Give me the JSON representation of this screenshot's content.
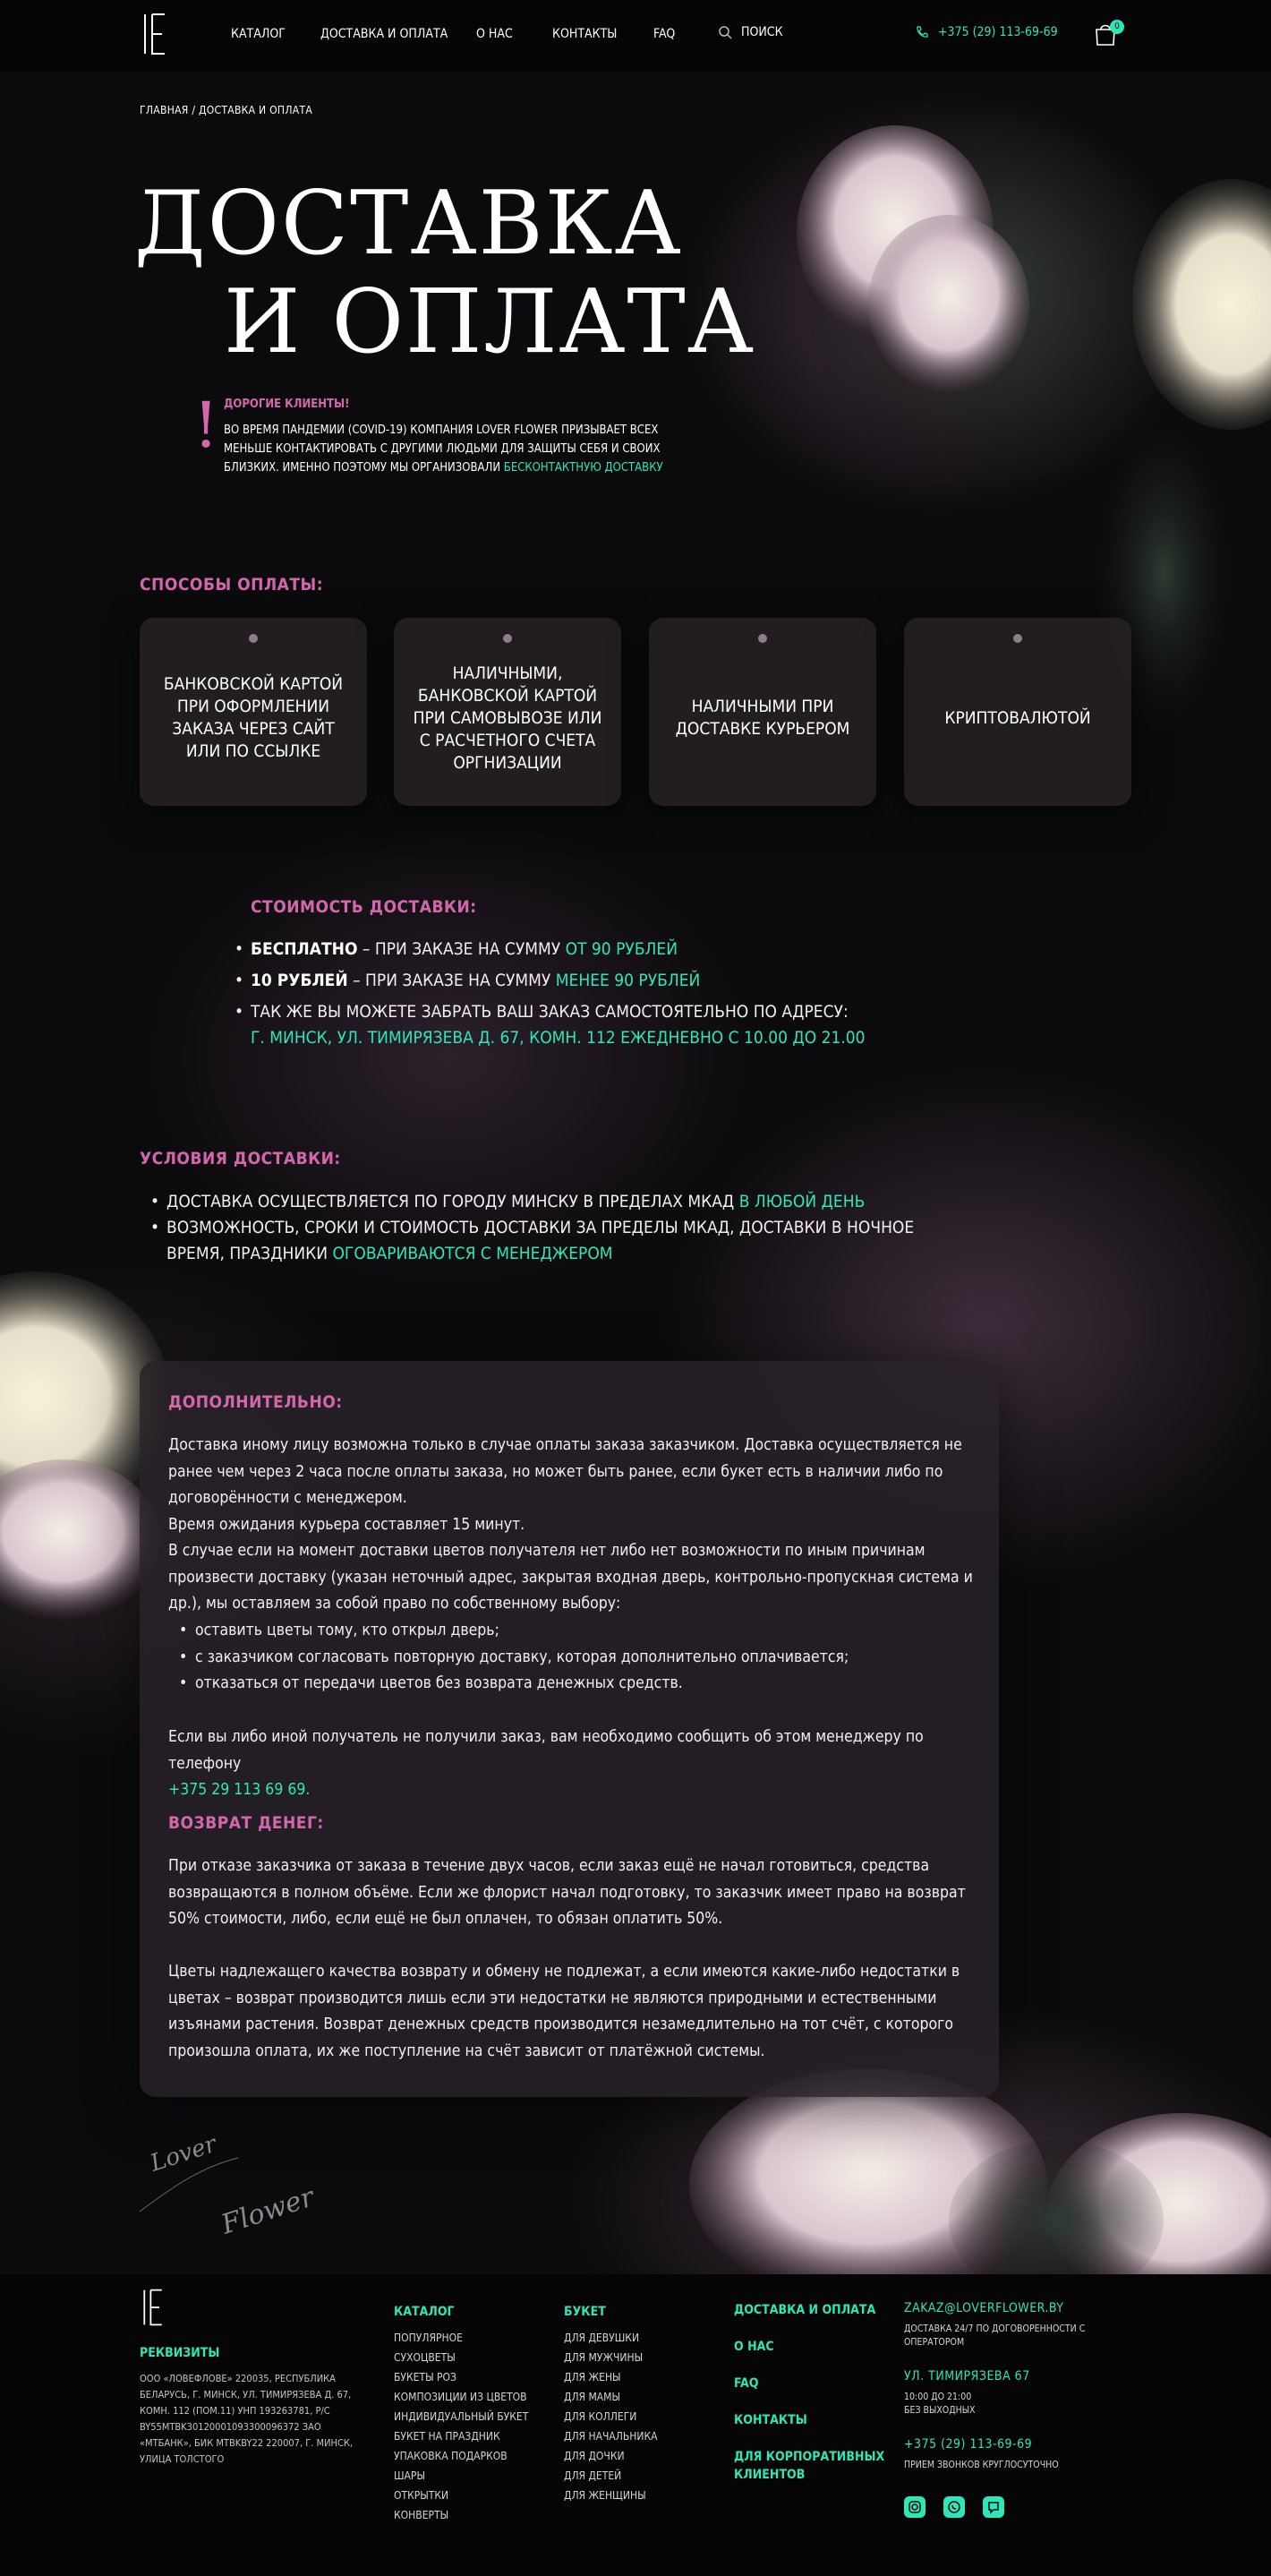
{
  "header": {
    "nav": [
      "КАТАЛОГ",
      "ДОСТАВКА И ОПЛАТА",
      "О НАС",
      "КОНТАКТЫ",
      "FAQ"
    ],
    "search_label": "ПОИСК",
    "phone": "+375 (29) 113-69-69",
    "cart_count": "0"
  },
  "breadcrumb": "ГЛАВНАЯ / ДОСТАВКА И ОПЛАТА",
  "title": {
    "line1": "ДОСТАВКА",
    "line2": "И ОПЛАТА"
  },
  "notice": {
    "mark": "!",
    "heading": "ДОРОГИЕ КЛИЕНТЫ!",
    "text": "ВО ВРЕМЯ ПАНДЕМИИ (COVID-19) КОМПАНИЯ LOVER FLOWER ПРИЗЫВАЕТ ВСЕХ МЕНЬШЕ КОНТАКТИРОВАТЬ С ДРУГИМИ ЛЮДЬМИ ДЛЯ ЗАЩИТЫ СЕБЯ И СВОИХ БЛИЗКИХ. ИМЕННО ПОЭТОМУ МЫ ОРГАНИЗОВАЛИ ",
    "link": "БЕСКОНТАКТНУЮ ДОСТАВКУ"
  },
  "payment": {
    "heading": "СПОСОБЫ ОПЛАТЫ:",
    "cards": [
      "БАНКОВСКОЙ КАРТОЙ ПРИ ОФОРМЛЕНИИ ЗАКАЗА ЧЕРЕЗ САЙТ ИЛИ ПО ССЫЛКЕ",
      "НАЛИЧНЫМИ, БАНКОВСКОЙ КАРТОЙ ПРИ САМОВЫВОЗЕ ИЛИ С РАСЧЕТНОГО СЧЕТА ОРГНИЗАЦИИ",
      "НАЛИЧНЫМИ ПРИ ДОСТАВКЕ КУРЬЕРОМ",
      "КРИПТОВАЛЮТОЙ"
    ]
  },
  "cost": {
    "heading": "СТОИМОСТЬ ДОСТАВКИ:",
    "free_bold": "БЕСПЛАТНО",
    "free_text": " – ПРИ ЗАКАЗЕ НА СУММУ ",
    "free_accent": "ОТ 90 РУБЛЕЙ",
    "paid_bold": "10 РУБЛЕЙ",
    "paid_text": " – ПРИ ЗАКАЗЕ НА СУММУ ",
    "paid_accent": "МЕНЕЕ 90 РУБЛЕЙ",
    "pickup_text": "ТАК ЖЕ ВЫ МОЖЕТЕ ЗАБРАТЬ ВАШ ЗАКАЗ САМОСТОЯТЕЛЬНО ПО АДРЕСУ:",
    "pickup_accent": "Г. МИНСК, УЛ. ТИМИРЯЗЕВА Д. 67, КОМН. 112 ЕЖЕДНЕВНО С 10.00 ДО 21.00"
  },
  "conditions": {
    "heading": "УСЛОВИЯ ДОСТАВКИ:",
    "item1_text": "ДОСТАВКА ОСУЩЕСТВЛЯЕТСЯ ПО ГОРОДУ МИНСКУ В ПРЕДЕЛАХ МКАД ",
    "item1_accent": "В ЛЮБОЙ ДЕНЬ",
    "item2_text": "ВОЗМОЖНОСТЬ, СРОКИ И СТОИМОСТЬ ДОСТАВКИ ЗА ПРЕДЕЛЫ МКАД, ДОСТАВКИ В НОЧНОЕ ВРЕМЯ, ПРАЗДНИКИ ",
    "item2_accent": "ОГОВАРИВАЮТСЯ С МЕНЕДЖЕРОМ"
  },
  "extra": {
    "heading": "ДОПОЛНИТЕЛЬНО:",
    "p1": "Доставка иному лицу возможна только в случае оплаты заказа заказчиком. Доставка осуществляется не ранее чем через 2 часа после оплаты заказа, но может быть ранее, если букет есть в наличии либо по договорённости с менеджером.",
    "p2": "Время ожидания курьера составляет 15 минут.",
    "p3": "В случае если на момент доставки цветов получателя нет либо нет возможности по иным причинам произвести доставку (указан неточный адрес, закрытая входная дверь, контрольно-пропускная система и др.), мы оставляем за собой право по собственному выбору:",
    "li1": "оставить цветы тому, кто открыл дверь;",
    "li2": "с заказчиком согласовать повторную доставку, которая дополнительно оплачивается;",
    "li3": "отказаться от передачи цветов без возврата денежных средств.",
    "p4": "Если вы либо иной получатель не получили заказ, вам необходимо сообщить об этом менеджеру по телефону",
    "p4_phone": "+375 29 113 69 69.",
    "refund_heading": "ВОЗВРАТ ДЕНЕГ:",
    "r1": "При отказе заказчика от заказа в течение двух часов, если заказ ещё не начал готовиться, средства возвращаются в полном объёме. Если же флорист начал подготовку, то заказчик имеет право на возврат 50% стоимости, либо, если ещё не был оплачен, то обязан оплатить 50%.",
    "r2": "Цветы надлежащего качества возврату и обмену не подлежат, а если имеются какие-либо недостатки в цветах – возврат производится лишь если эти недостатки не являются природными и естественными изъянами растения. Возврат денежных средств производится незамедлительно на тот счёт, с которого произошла оплата, их же поступление на счёт зависит от платёжной системы."
  },
  "signature": {
    "line1": "Lover",
    "line2": "Flower"
  },
  "footer": {
    "requisites_heading": "РЕКВИЗИТЫ",
    "requisites": "ООО «ЛОВЕФЛОВЕ» 220035, РЕСПУБЛИКА БЕЛАРУСЬ, Г. МИНСК, УЛ. ТИМИРЯЗЕВА Д. 67, КОМН. 112 (ПОМ.11) УНП 193263781, Р/С BY55MTBK30120001093300096372 ЗАО «МТБАНК», БИК MTBKBY22 220007, Г. МИНСК, УЛИЦА ТОЛСТОГО",
    "catalog_heading": "КАТАЛОГ",
    "catalog": [
      "ПОПУЛЯРНОЕ",
      "СУХОЦВЕТЫ",
      "БУКЕТЫ РОЗ",
      "КОМПОЗИЦИИ ИЗ ЦВЕТОВ",
      "ИНДИВИДУАЛЬНЫЙ БУКЕТ",
      "БУКЕТ НА ПРАЗДНИК",
      "УПАКОВКА ПОДАРКОВ",
      "ШАРЫ",
      "ОТКРЫТКИ",
      "КОНВЕРТЫ"
    ],
    "bouquet_heading": "БУКЕТ",
    "bouquet": [
      "ДЛЯ ДЕВУШКИ",
      "ДЛЯ МУЖЧИНЫ",
      "ДЛЯ ЖЕНЫ",
      "ДЛЯ МАМЫ",
      "ДЛЯ КОЛЛЕГИ",
      "ДЛЯ НАЧАЛЬНИКА",
      "ДЛЯ ДОЧКИ",
      "ДЛЯ ДЕТЕЙ",
      "ДЛЯ ЖЕНЩИНЫ"
    ],
    "links": [
      "ДОСТАВКА И ОПЛАТА",
      "О НАС",
      "FAQ",
      "КОНТАКТЫ",
      "ДЛЯ КОРПОРАТИВНЫХ КЛИЕНТОВ"
    ],
    "email": "ZAKAZ@LOVERFLOWER.BY",
    "email_note": "ДОСТАВКА 24/7 ПО ДОГОВОРЕННОСТИ С ОПЕРАТОРОМ",
    "address": "УЛ. ТИМИРЯЗЕВА 67",
    "hours": "10:00 ДО 21:00",
    "hours_note": "БЕЗ ВЫХОДНЫХ",
    "phone": "+375 (29) 113-69-69",
    "phone_note": "ПРИЕМ ЗВОНКОВ КРУГЛОСУТОЧНО"
  },
  "colors": {
    "accent": "#2ee6b7",
    "pink": "#d467ab",
    "background": "#0b0a0c"
  }
}
